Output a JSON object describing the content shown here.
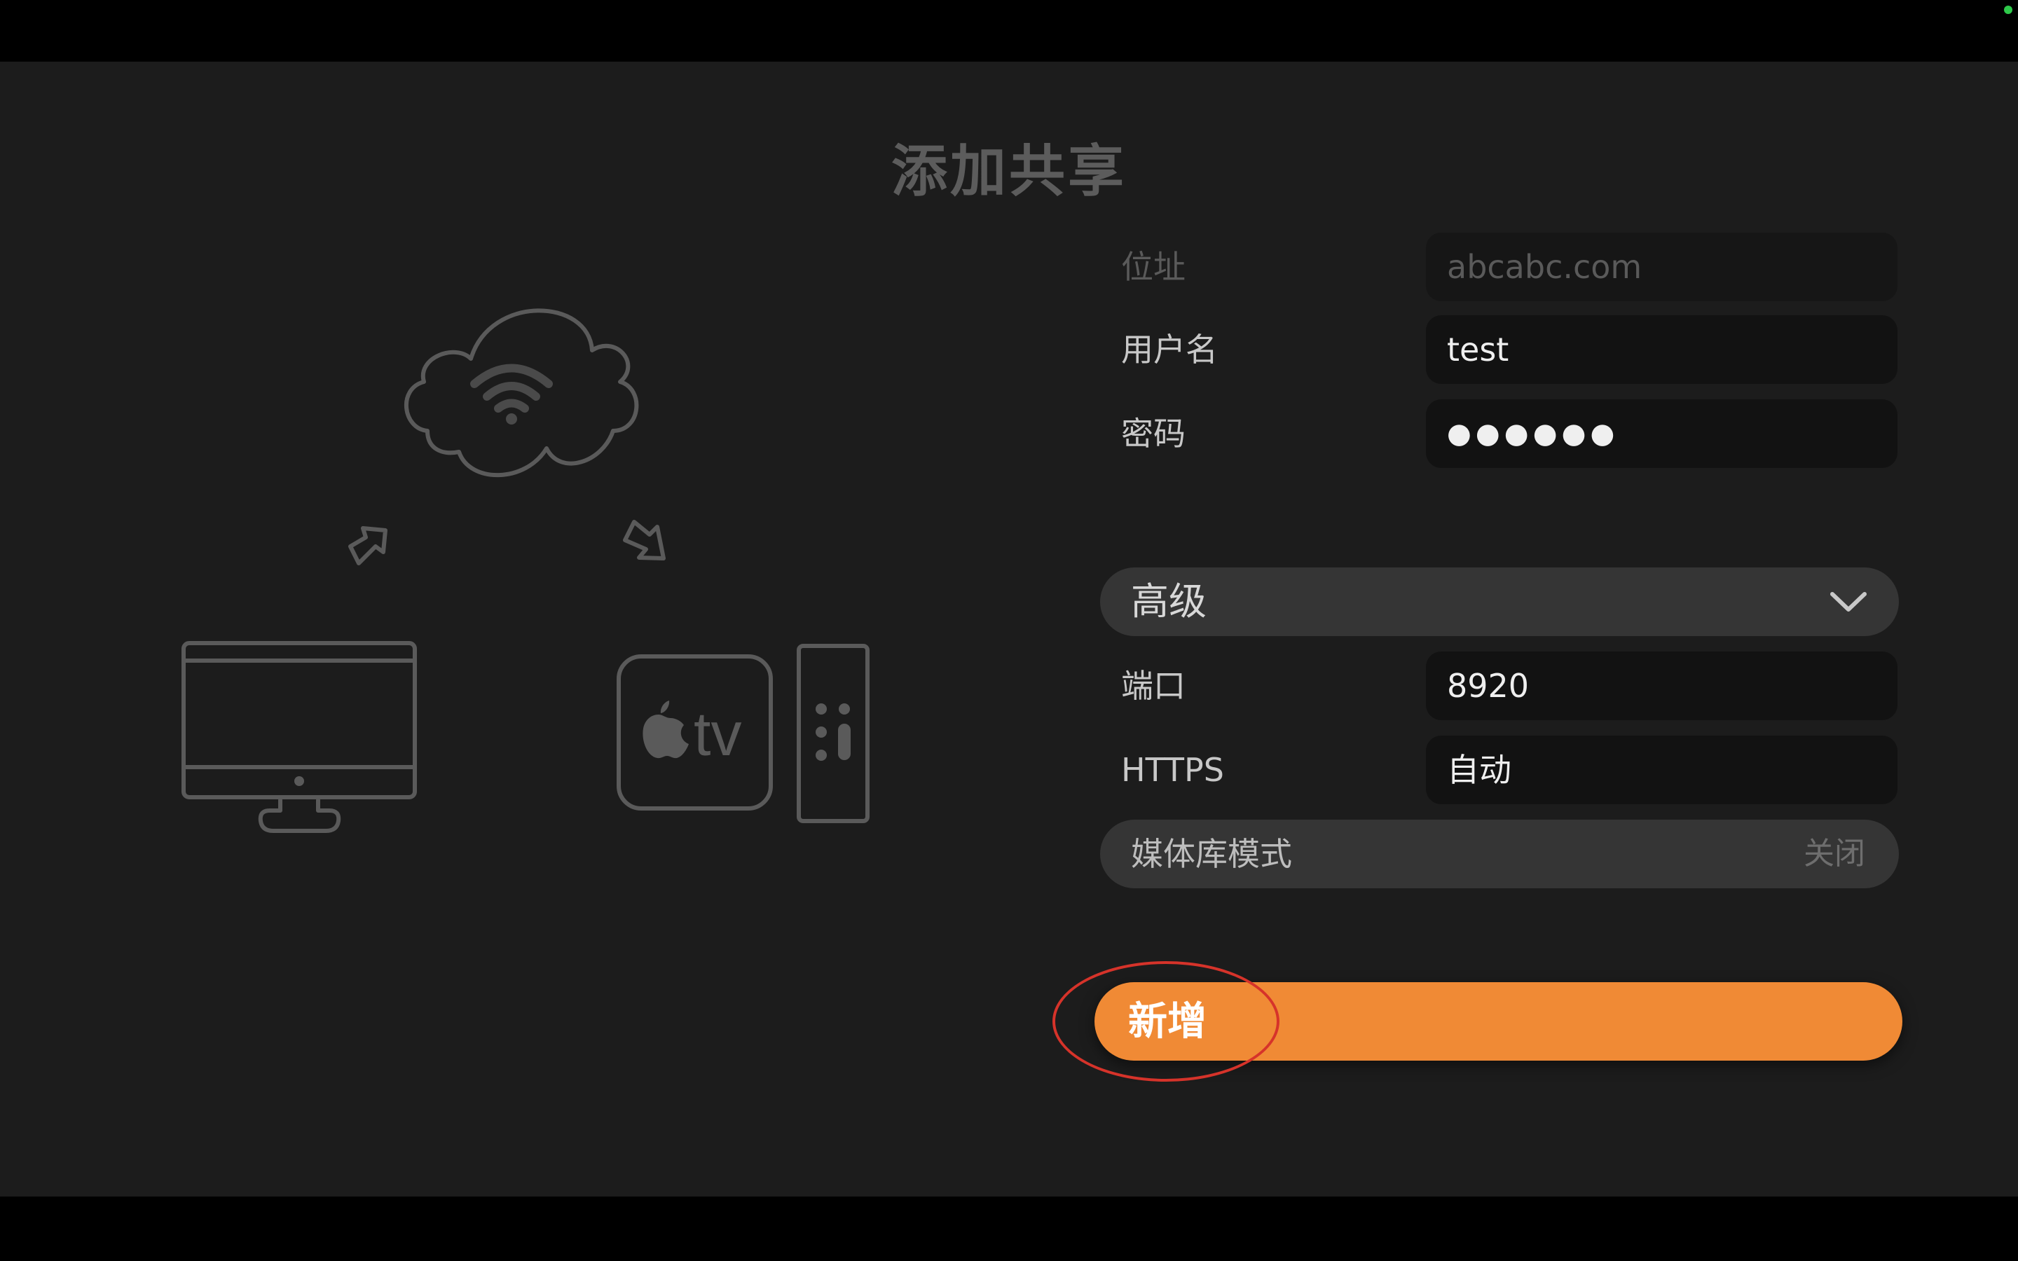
{
  "title": "添加共享",
  "fields": {
    "address": {
      "label": "位址",
      "placeholder": "abcabc.com"
    },
    "username": {
      "label": "用户名",
      "value": "test"
    },
    "password": {
      "label": "密码",
      "value": "●●●●●●"
    }
  },
  "advanced": {
    "label": "高级",
    "icon": "chevron-down-icon"
  },
  "advanced_fields": {
    "port": {
      "label": "端口",
      "value": "8920"
    },
    "https": {
      "label": "HTTPS",
      "value": "自动"
    }
  },
  "library_mode": {
    "label": "媒体库模式",
    "value": "关闭"
  },
  "add_button": {
    "label": "新增"
  },
  "illustration": {
    "tv_label": "tv",
    "icons": [
      "cloud-wifi-icon",
      "upload-arrow-icon",
      "download-arrow-icon",
      "imac-icon",
      "apple-tv-icon",
      "remote-icon"
    ]
  },
  "colors": {
    "accent": "#f08a35",
    "highlight_ring": "#d6332a",
    "background": "#1c1c1c",
    "status_dot": "#2ec94a"
  }
}
